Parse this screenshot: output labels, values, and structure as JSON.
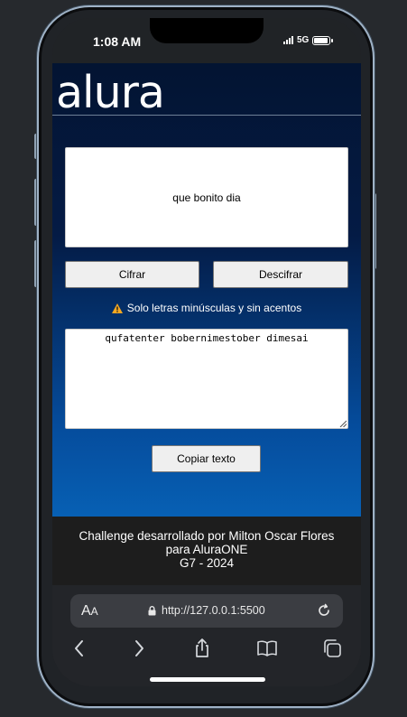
{
  "status_bar": {
    "time": "1:08 AM",
    "network": "5G",
    "battery_fraction": 0.9
  },
  "brand": {
    "logo": "alura"
  },
  "input": {
    "value": "que bonito dia"
  },
  "buttons": {
    "encrypt": "Cifrar",
    "decrypt": "Descifrar",
    "copy": "Copiar texto"
  },
  "notice": {
    "text": "Solo letras minúsculas y sin acentos",
    "icon": "warning-icon",
    "icon_color": "#f6a821"
  },
  "output": {
    "value": "qufatenter bobernimestober dimesai"
  },
  "footer": {
    "line1": "Challenge desarrollado por Milton Oscar Flores",
    "line2": "para AluraONE",
    "line3": "G7 - 2024"
  },
  "browser": {
    "aa_label_big": "A",
    "aa_label_small": "A",
    "url": "http://127.0.0.1:5500",
    "tools": [
      "back-icon",
      "forward-icon",
      "share-icon",
      "bookmarks-icon",
      "tabs-icon"
    ]
  },
  "colors": {
    "header_bg": "#031432",
    "gradient_bottom": "#0760b4",
    "footer_bg": "#1d1d1d"
  }
}
